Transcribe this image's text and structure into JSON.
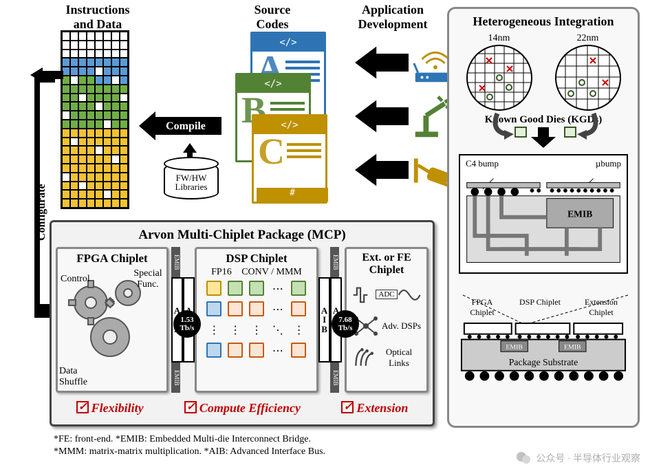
{
  "titles": {
    "instructions": "Instructions and Data",
    "source_codes": "Source Codes",
    "app_dev": "Application Development",
    "het": "Heterogeneous Integration"
  },
  "flow": {
    "compile": "Compile",
    "configurate": "Configurate",
    "fw_hw_lib": "FW/HW\nLibraries"
  },
  "source_docs": {
    "a": "A",
    "b": "B",
    "c": "C",
    "code_tag": "</>",
    "hash": "#"
  },
  "mcp": {
    "title": "Arvon Multi-Chiplet Package (MCP)",
    "fpga": {
      "title": "FPGA Chiplet",
      "control": "Control",
      "special": "Special Func.",
      "data": "Data Shuffle"
    },
    "dsp": {
      "title": "DSP Chiplet",
      "fp16": "FP16",
      "conv": "CONV / MMM"
    },
    "ext": {
      "title": "Ext. or FE Chiplet",
      "adc": "ADC",
      "adv": "Adv. DSPs",
      "optical": "Optical Links"
    },
    "emib": "EMIB",
    "aib": "AIB",
    "bw1": "1.53 Tb/s",
    "bw2": "7.68 Tb/s",
    "benefits": [
      "Flexibility",
      "Compute Efficiency",
      "Extension"
    ]
  },
  "footnotes": {
    "l1": "*FE: front-end. *EMIB: Embedded Multi-die Interconnect Bridge.",
    "l2": "*MMM: matrix-matrix multiplication. *AIB: Advanced Interface Bus."
  },
  "het": {
    "nm14": "14nm",
    "nm22": "22nm",
    "kgd": "Known Good Dies (KGDs)",
    "c4": "C4 bump",
    "ubump": "µbump",
    "emib": "EMIB",
    "fpga": "FPGA Chiplet",
    "dsp": "DSP Chiplet",
    "extc": "Extension Chiplet",
    "pkg": "Package Substrate"
  },
  "watermark": "公众号 · 半导体行业观察"
}
